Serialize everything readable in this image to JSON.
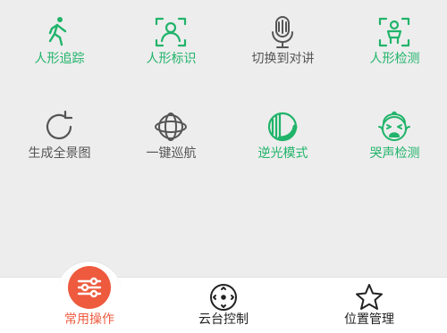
{
  "colors": {
    "accent_green": "#20b46a",
    "text_gray": "#555555",
    "icon_gray": "#555555",
    "nav_active": "#ee5a3e",
    "nav_text": "#222222",
    "background": "#ededed"
  },
  "grid": {
    "items": [
      {
        "label": "人形追踪",
        "icon": "walking-person-icon",
        "active": true
      },
      {
        "label": "人形标识",
        "icon": "person-frame-icon",
        "active": true
      },
      {
        "label": "切换到对讲",
        "icon": "microphone-icon",
        "active": false
      },
      {
        "label": "人形检测",
        "icon": "person-detect-icon",
        "active": true
      },
      {
        "label": "生成全景图",
        "icon": "refresh-icon",
        "active": false
      },
      {
        "label": "一键巡航",
        "icon": "orbit-icon",
        "active": false
      },
      {
        "label": "逆光模式",
        "icon": "backlight-icon",
        "active": true
      },
      {
        "label": "哭声检测",
        "icon": "crying-face-icon",
        "active": true
      }
    ]
  },
  "bottom_nav": {
    "items": [
      {
        "label": "常用操作",
        "icon": "sliders-icon",
        "active": true
      },
      {
        "label": "云台控制",
        "icon": "ptz-control-icon",
        "active": false
      },
      {
        "label": "位置管理",
        "icon": "star-icon",
        "active": false
      }
    ]
  }
}
